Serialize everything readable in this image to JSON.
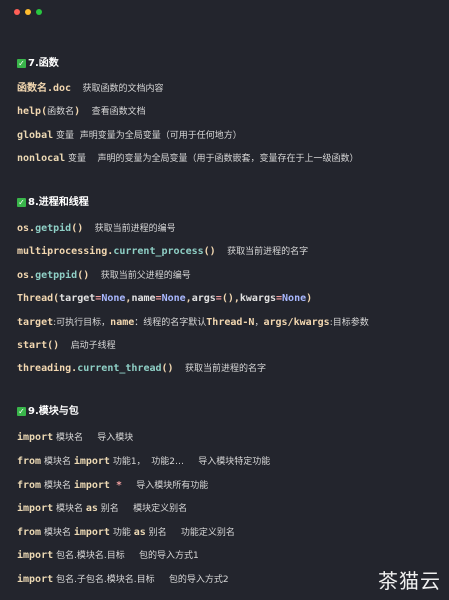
{
  "window": {
    "buttons": [
      {
        "name": "close",
        "color": "#ff5f57"
      },
      {
        "name": "minimize",
        "color": "#febc2e"
      },
      {
        "name": "maximize",
        "color": "#28c840"
      }
    ]
  },
  "sections": [
    {
      "heading_number": "7.",
      "heading_text": "函数",
      "lines": [
        [
          [
            "code",
            "函数名"
          ],
          [
            "code",
            ".doc"
          ],
          [
            "cn",
            "    获取函数的文档内容"
          ]
        ],
        [
          [
            "code",
            "help"
          ],
          [
            "code",
            "("
          ],
          [
            "cn",
            "函数名"
          ],
          [
            "code",
            ")"
          ],
          [
            "cn",
            "    查看函数文档"
          ]
        ],
        [
          [
            "keyword",
            "global"
          ],
          [
            "cn",
            " 变量  声明变量为全局变量（可用于任何地方）"
          ]
        ],
        [
          [
            "keyword",
            "nonlocal"
          ],
          [
            "cn",
            " 变量    声明的变量为全局变量（用于函数嵌套，变量存在于上一级函数）"
          ]
        ]
      ]
    },
    {
      "heading_number": "8.",
      "heading_text": "进程和线程",
      "lines": [
        [
          [
            "code",
            "os."
          ],
          [
            "fn",
            "getpid"
          ],
          [
            "code",
            "()"
          ],
          [
            "cn",
            "    获取当前进程的编号"
          ]
        ],
        [
          [
            "code",
            "multiprocessing."
          ],
          [
            "fn",
            "current_process"
          ],
          [
            "code",
            "()"
          ],
          [
            "cn",
            "    获取当前进程的名字"
          ]
        ],
        [
          [
            "code",
            "os."
          ],
          [
            "fn",
            "getppid"
          ],
          [
            "code",
            "()"
          ],
          [
            "cn",
            "    获取当前父进程的编号"
          ]
        ],
        [
          [
            "code",
            "Thread("
          ],
          [
            "name",
            "target"
          ],
          [
            "op",
            "="
          ],
          [
            "hl",
            "None"
          ],
          [
            "code",
            ","
          ],
          [
            "name",
            "name"
          ],
          [
            "op",
            "="
          ],
          [
            "hl",
            "None"
          ],
          [
            "code",
            ","
          ],
          [
            "name",
            "args"
          ],
          [
            "op",
            "="
          ],
          [
            "code",
            "(),"
          ],
          [
            "name",
            "kwargs"
          ],
          [
            "op",
            "="
          ],
          [
            "hl",
            "None"
          ],
          [
            "code",
            ")"
          ]
        ],
        [
          [
            "code",
            "target"
          ],
          [
            "cn",
            ":可执行目标，"
          ],
          [
            "code",
            "name"
          ],
          [
            "cn",
            "：线程的名字默认"
          ],
          [
            "code",
            "Thread-N"
          ],
          [
            "cn",
            "，"
          ],
          [
            "code",
            "args/kwargs"
          ],
          [
            "cn",
            ":目标参数"
          ]
        ],
        [
          [
            "code",
            "start()"
          ],
          [
            "cn",
            "    启动子线程"
          ]
        ],
        [
          [
            "code",
            "threading."
          ],
          [
            "fn",
            "current_thread"
          ],
          [
            "code",
            "()"
          ],
          [
            "cn",
            "    获取当前进程的名字"
          ]
        ]
      ]
    },
    {
      "heading_number": "9.",
      "heading_text": "模块与包",
      "lines": [
        [
          [
            "keyword",
            "import"
          ],
          [
            "cn",
            " 模块名     导入模块"
          ]
        ],
        [
          [
            "keyword",
            "from"
          ],
          [
            "cn",
            " 模块名 "
          ],
          [
            "keyword",
            "import"
          ],
          [
            "cn",
            " 功能1，  功能2…     导入模块特定功能"
          ]
        ],
        [
          [
            "keyword",
            "from"
          ],
          [
            "cn",
            " 模块名 "
          ],
          [
            "keyword",
            "import"
          ],
          [
            "op",
            " *"
          ],
          [
            "cn",
            "     导入模块所有功能"
          ]
        ],
        [
          [
            "keyword",
            "import"
          ],
          [
            "cn",
            " 模块名 "
          ],
          [
            "keyword",
            "as"
          ],
          [
            "cn",
            " 别名     模块定义别名"
          ]
        ],
        [
          [
            "keyword",
            "from"
          ],
          [
            "cn",
            " 模块名 "
          ],
          [
            "keyword",
            "import"
          ],
          [
            "cn",
            " 功能 "
          ],
          [
            "keyword",
            "as"
          ],
          [
            "cn",
            " 别名     功能定义别名"
          ]
        ],
        [
          [
            "keyword",
            "import"
          ],
          [
            "cn",
            " 包名.模块名.目标     包的导入方式1"
          ]
        ],
        [
          [
            "keyword",
            "import"
          ],
          [
            "cn",
            " 包名.子包名.模块名.目标     包的导入方式2"
          ]
        ]
      ]
    }
  ],
  "watermark": "茶猫云"
}
